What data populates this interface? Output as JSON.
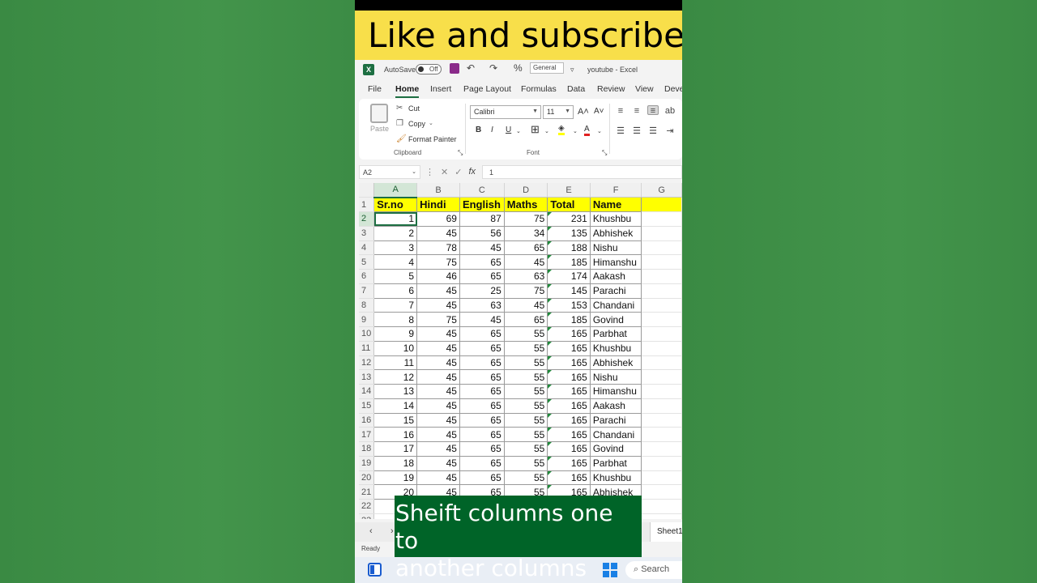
{
  "banner_text": "Like and subscribe",
  "caption_lines": [
    "Sheift columns one to",
    "another columns"
  ],
  "colors": {
    "excel_green": "#1d6f42",
    "header_fill": "#ffff00",
    "banner_yellow": "#f8df4a",
    "caption_bg": "#006428",
    "page_bg": "#3d8b45"
  },
  "titlebar": {
    "autosave_label": "AutoSave",
    "autosave_state": "Off",
    "number_format": "General",
    "file_title": "youtube - Excel"
  },
  "tabs": [
    "File",
    "Home",
    "Insert",
    "Page Layout",
    "Formulas",
    "Data",
    "Review",
    "View",
    "Deve"
  ],
  "active_tab": "Home",
  "clipboard": {
    "paste": "Paste",
    "cut": "Cut",
    "copy": "Copy",
    "format_painter": "Format Painter",
    "label": "Clipboard"
  },
  "font_group": {
    "font_name": "Calibri",
    "font_size": "11",
    "label": "Font",
    "bold": "B",
    "italic": "I",
    "underline": "U"
  },
  "formula_bar": {
    "name_box": "A2",
    "fx": "fx",
    "value": "1"
  },
  "columns": [
    "A",
    "B",
    "C",
    "D",
    "E",
    "F",
    "G"
  ],
  "headers": [
    "Sr.no",
    "Hindi",
    "English",
    "Maths",
    "Total",
    "Name"
  ],
  "rows": [
    [
      "1",
      "69",
      "87",
      "75",
      "231",
      "Khushbu"
    ],
    [
      "2",
      "45",
      "56",
      "34",
      "135",
      "Abhishek"
    ],
    [
      "3",
      "78",
      "45",
      "65",
      "188",
      "Nishu"
    ],
    [
      "4",
      "75",
      "65",
      "45",
      "185",
      "Himanshu"
    ],
    [
      "5",
      "46",
      "65",
      "63",
      "174",
      "Aakash"
    ],
    [
      "6",
      "45",
      "25",
      "75",
      "145",
      "Parachi"
    ],
    [
      "7",
      "45",
      "63",
      "45",
      "153",
      "Chandani"
    ],
    [
      "8",
      "75",
      "45",
      "65",
      "185",
      "Govind"
    ],
    [
      "9",
      "45",
      "65",
      "55",
      "165",
      "Parbhat"
    ],
    [
      "10",
      "45",
      "65",
      "55",
      "165",
      "Khushbu"
    ],
    [
      "11",
      "45",
      "65",
      "55",
      "165",
      "Abhishek"
    ],
    [
      "12",
      "45",
      "65",
      "55",
      "165",
      "Nishu"
    ],
    [
      "13",
      "45",
      "65",
      "55",
      "165",
      "Himanshu"
    ],
    [
      "14",
      "45",
      "65",
      "55",
      "165",
      "Aakash"
    ],
    [
      "15",
      "45",
      "65",
      "55",
      "165",
      "Parachi"
    ],
    [
      "16",
      "45",
      "65",
      "55",
      "165",
      "Chandani"
    ],
    [
      "17",
      "45",
      "65",
      "55",
      "165",
      "Govind"
    ],
    [
      "18",
      "45",
      "65",
      "55",
      "165",
      "Parbhat"
    ],
    [
      "19",
      "45",
      "65",
      "55",
      "165",
      "Khushbu"
    ],
    [
      "20",
      "45",
      "65",
      "55",
      "165",
      "Abhishek"
    ]
  ],
  "extra_row_numbers": [
    "22",
    "23"
  ],
  "sheet_tab": "Sheet1",
  "status": "Ready",
  "taskbar": {
    "search": "Search"
  }
}
